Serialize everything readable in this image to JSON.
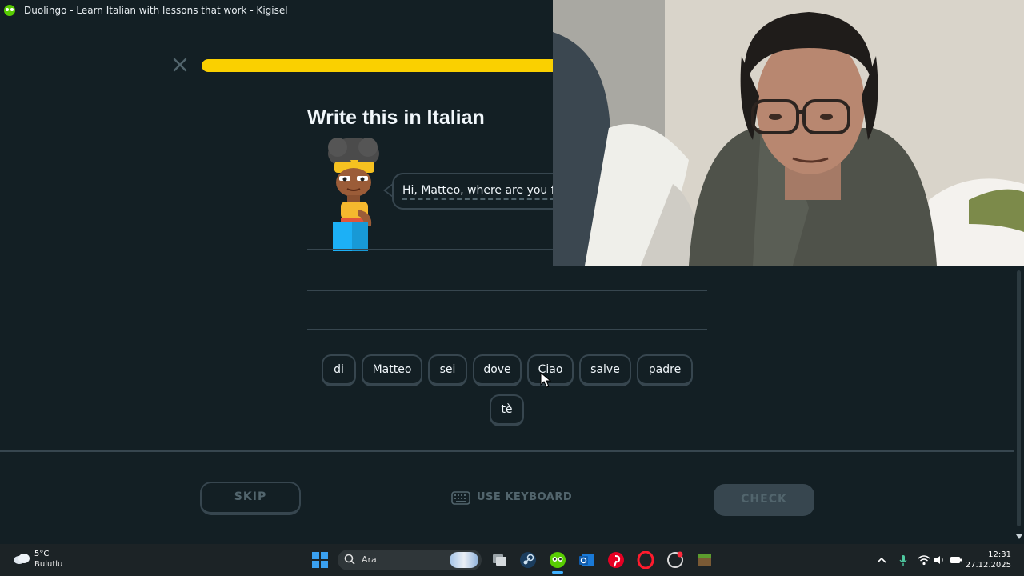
{
  "window": {
    "title": "Duolingo - Learn Italian with lessons that work - Kigisel"
  },
  "lesson": {
    "progress_fraction": 0.9,
    "prompt_title": "Write this in Italian",
    "sentence_visible": "Hi, Matteo, where are you f",
    "word_bank": [
      "di",
      "Matteo",
      "sei",
      "dove",
      "Ciao",
      "salve",
      "padre",
      "tè"
    ]
  },
  "footer": {
    "skip_label": "SKIP",
    "keyboard_label": "USE KEYBOARD",
    "check_label": "CHECK"
  },
  "taskbar": {
    "weather_temp": "5°C",
    "weather_condition": "Bulutlu",
    "search_placeholder": "Ara",
    "time": "12:31",
    "date": "27.12.2025"
  },
  "colors": {
    "background": "#131f24",
    "progress": "#fad000",
    "border": "#37464f",
    "muted_text": "#52656d",
    "accent_green": "#58cc02"
  }
}
